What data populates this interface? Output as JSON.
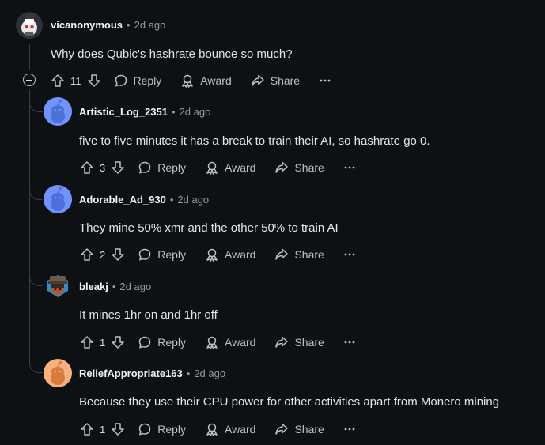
{
  "actions": {
    "reply": "Reply",
    "award": "Award",
    "share": "Share"
  },
  "colors": {
    "background": "#0e1113",
    "thread_line": "#3a3f44",
    "muted_text": "#8b9ca4"
  },
  "comments": [
    {
      "user": "vicanonymous",
      "time": "2d ago",
      "body": "Why does Qubic's hashrate bounce so much?",
      "votes": "11",
      "avatar": "reddit-snoo-custom"
    },
    {
      "user": "Artistic_Log_2351",
      "time": "2d ago",
      "body": "five to five minutes it has a break to train their AI, so hashrate go 0.",
      "votes": "3",
      "avatar": "default-snoo-blue"
    },
    {
      "user": "Adorable_Ad_930",
      "time": "2d ago",
      "body": "They mine 50% xmr and the other 50% to train AI",
      "votes": "2",
      "avatar": "default-snoo-blue"
    },
    {
      "user": "bleakj",
      "time": "2d ago",
      "body": "It mines 1hr on and 1hr off",
      "votes": "1",
      "avatar": "snoo-hat-custom"
    },
    {
      "user": "ReliefAppropriate163",
      "time": "2d ago",
      "body": "Because they use their CPU power for other activities apart from Monero mining",
      "votes": "1",
      "avatar": "default-snoo-orange"
    }
  ]
}
